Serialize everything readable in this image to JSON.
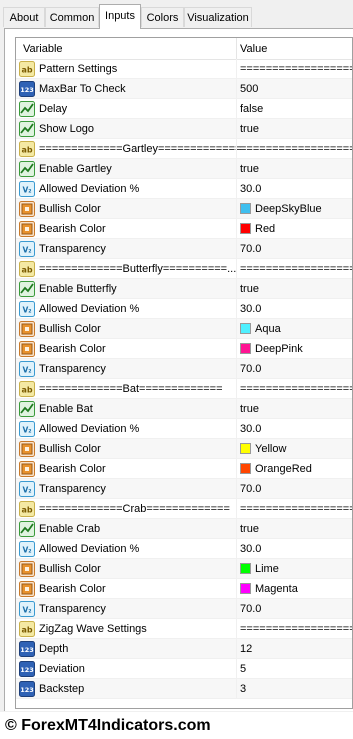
{
  "tabs": [
    "About",
    "Common",
    "Inputs",
    "Colors",
    "Visualization"
  ],
  "active_tab": "Inputs",
  "table": {
    "col_variable": "Variable",
    "col_value": "Value",
    "rows": [
      {
        "icon": "ab",
        "variable": "Pattern Settings",
        "value": "====================="
      },
      {
        "icon": "123",
        "variable": "MaxBar To Check",
        "value": "500"
      },
      {
        "icon": "bool",
        "variable": "Delay",
        "value": "false"
      },
      {
        "icon": "bool",
        "variable": "Show Logo",
        "value": "true"
      },
      {
        "icon": "ab",
        "variable": "=============Gartley=============",
        "value": "====================="
      },
      {
        "icon": "bool",
        "variable": "Enable Gartley",
        "value": "true"
      },
      {
        "icon": "dbl",
        "variable": "Allowed Deviation %",
        "value": "30.0"
      },
      {
        "icon": "clr",
        "variable": "Bullish Color",
        "value": "DeepSkyBlue",
        "swatch": "#3fbfef"
      },
      {
        "icon": "clr",
        "variable": "Bearish Color",
        "value": "Red",
        "swatch": "#ff0000"
      },
      {
        "icon": "dbl",
        "variable": "Transparency",
        "value": "70.0"
      },
      {
        "icon": "ab",
        "variable": "=============Butterfly==========...",
        "value": "====================="
      },
      {
        "icon": "bool",
        "variable": "Enable Butterfly",
        "value": "true"
      },
      {
        "icon": "dbl",
        "variable": "Allowed Deviation %",
        "value": "30.0"
      },
      {
        "icon": "clr",
        "variable": "Bullish Color",
        "value": "Aqua",
        "swatch": "#4ff0ff"
      },
      {
        "icon": "clr",
        "variable": "Bearish Color",
        "value": "DeepPink",
        "swatch": "#ff1493"
      },
      {
        "icon": "dbl",
        "variable": "Transparency",
        "value": "70.0"
      },
      {
        "icon": "ab",
        "variable": "=============Bat=============",
        "value": "====================="
      },
      {
        "icon": "bool",
        "variable": "Enable Bat",
        "value": "true"
      },
      {
        "icon": "dbl",
        "variable": "Allowed Deviation %",
        "value": "30.0"
      },
      {
        "icon": "clr",
        "variable": "Bullish Color",
        "value": "Yellow",
        "swatch": "#ffff00"
      },
      {
        "icon": "clr",
        "variable": "Bearish Color",
        "value": "OrangeRed",
        "swatch": "#ff4500"
      },
      {
        "icon": "dbl",
        "variable": "Transparency",
        "value": "70.0"
      },
      {
        "icon": "ab",
        "variable": "=============Crab=============",
        "value": "====================="
      },
      {
        "icon": "bool",
        "variable": "Enable Crab",
        "value": "true"
      },
      {
        "icon": "dbl",
        "variable": "Allowed Deviation %",
        "value": "30.0"
      },
      {
        "icon": "clr",
        "variable": "Bullish Color",
        "value": "Lime",
        "swatch": "#00ff00"
      },
      {
        "icon": "clr",
        "variable": "Bearish Color",
        "value": "Magenta",
        "swatch": "#ff00ff"
      },
      {
        "icon": "dbl",
        "variable": "Transparency",
        "value": "70.0"
      },
      {
        "icon": "ab",
        "variable": "ZigZag Wave Settings",
        "value": "====================="
      },
      {
        "icon": "123",
        "variable": "Depth",
        "value": "12"
      },
      {
        "icon": "123",
        "variable": "Deviation",
        "value": "5"
      },
      {
        "icon": "123",
        "variable": "Backstep",
        "value": "3"
      }
    ]
  },
  "footer": "© ForexMT4Indicators.com"
}
